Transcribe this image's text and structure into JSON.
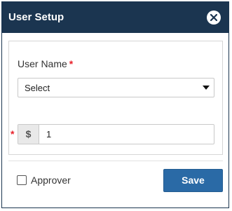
{
  "dialog": {
    "title": "User Setup",
    "close_icon": "close-circle-icon"
  },
  "form": {
    "user_name": {
      "label": "User Name",
      "required_mark": "*",
      "selected_value": "Select"
    },
    "amount": {
      "required_mark": "*",
      "currency_symbol": "$",
      "value": "1"
    }
  },
  "footer": {
    "approver_label": "Approver",
    "approver_checked": false,
    "save_label": "Save"
  },
  "colors": {
    "header_bg": "#1b3550",
    "primary_button": "#2a6aa6",
    "required": "#e8202a"
  }
}
